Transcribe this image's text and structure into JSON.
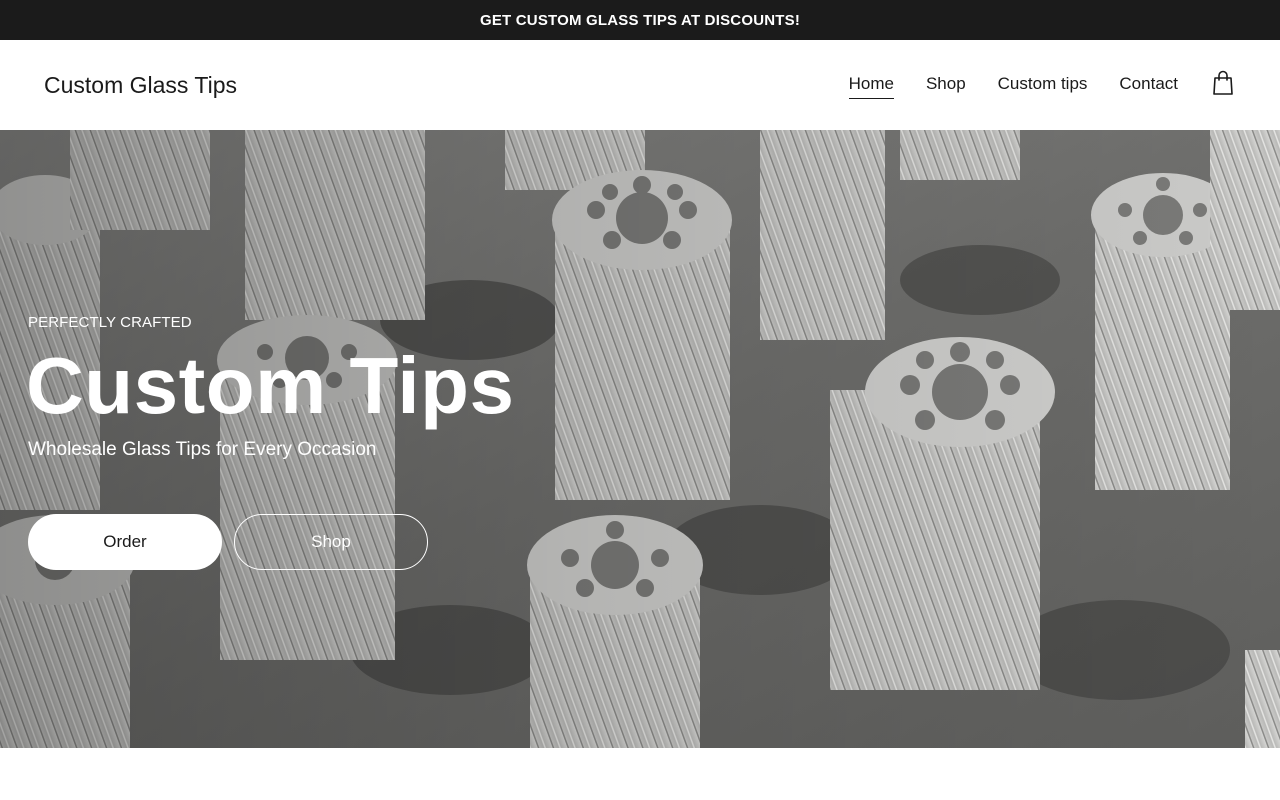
{
  "announcement": {
    "text": "GET CUSTOM GLASS TIPS AT DISCOUNTS!"
  },
  "header": {
    "logo": "Custom Glass Tips",
    "nav": [
      {
        "label": "Home",
        "active": true
      },
      {
        "label": "Shop",
        "active": false
      },
      {
        "label": "Custom tips",
        "active": false
      },
      {
        "label": "Contact",
        "active": false
      }
    ],
    "cart_icon": "shopping-bag-icon"
  },
  "hero": {
    "eyebrow": "PERFECTLY CRAFTED",
    "title": "Custom Tips",
    "subtitle": "Wholesale Glass Tips for Every Occasion",
    "buttons": {
      "primary": "Order",
      "secondary": "Shop"
    },
    "image": "photo of twisted glass filter tips with hole pattern on a metal surface"
  },
  "colors": {
    "announcement_bg": "#1b1b1b",
    "header_bg": "#ffffff",
    "text": "#1a1a1a",
    "hero_text": "#ffffff"
  }
}
